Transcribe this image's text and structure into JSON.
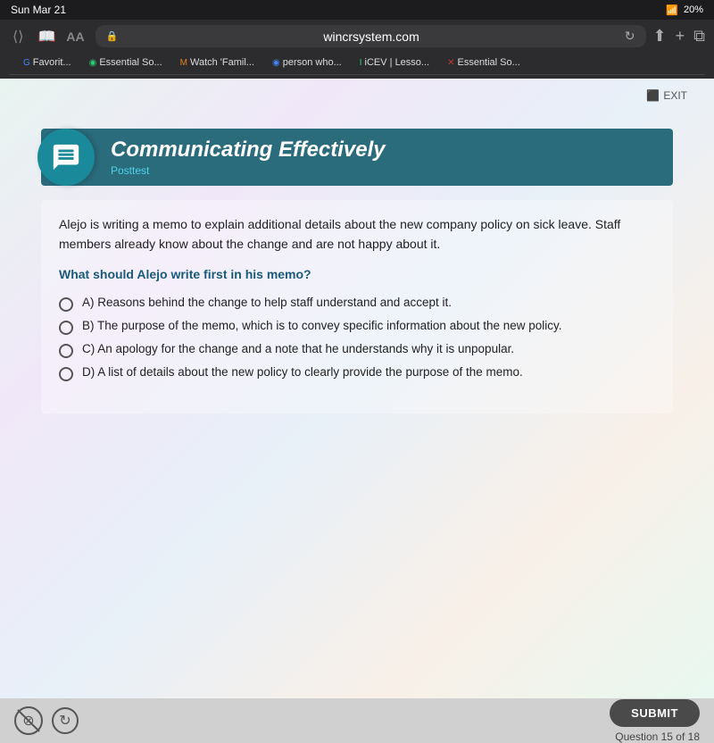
{
  "statusBar": {
    "date": "Sun Mar 21",
    "wifi": "wifi",
    "battery": "20%"
  },
  "browser": {
    "backBtn": "‹",
    "addressBar": {
      "url": "wincrsystem.com",
      "lockIcon": "🔒"
    },
    "reloadBtn": "↻",
    "addBtn": "+",
    "shareBtn": "⬆"
  },
  "bookmarks": [
    {
      "icon": "G",
      "label": "Favorit...",
      "iconClass": "bk-google"
    },
    {
      "icon": "◉",
      "label": "Essential So...",
      "iconClass": "bk-green"
    },
    {
      "icon": "M",
      "label": "Watch 'Famil...",
      "iconClass": "bk-orange"
    },
    {
      "icon": "◉",
      "label": "person who...",
      "iconClass": "bk-google"
    },
    {
      "icon": "I",
      "label": "iCEV | Lesso...",
      "iconClass": "bk-green"
    },
    {
      "icon": "✕",
      "label": "Essential So...",
      "iconClass": ""
    }
  ],
  "lesson": {
    "exitLabel": "EXIT",
    "iconAlt": "communication-icon",
    "title": "Communicating Effectively",
    "subtitle": "Posttest",
    "scenario": "Alejo is writing a memo to explain additional details about the new company policy on sick leave. Staff members already know about the change and are not happy about it.",
    "questionPrompt": "What should Alejo write first in his memo?",
    "options": [
      {
        "id": "A",
        "text": "A) Reasons behind the change to help staff understand and accept it."
      },
      {
        "id": "B",
        "text": "B) The purpose of the memo, which is to convey specific information about the new policy."
      },
      {
        "id": "C",
        "text": "C) An apology for the change and a note that he understands why it is unpopular."
      },
      {
        "id": "D",
        "text": "D) A list of details about the new policy to clearly provide the purpose of the memo."
      }
    ],
    "submitLabel": "SUBMIT",
    "questionCounter": "Question 15 of 18"
  }
}
